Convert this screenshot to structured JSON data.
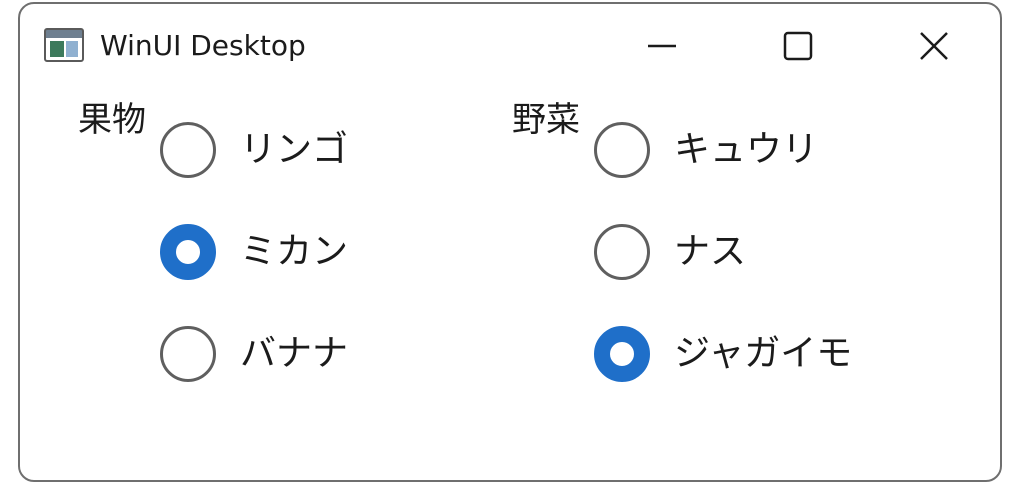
{
  "window": {
    "title": "WinUI Desktop"
  },
  "caption_buttons": {
    "minimize": "minimize-icon",
    "maximize": "maximize-icon",
    "close": "close-icon"
  },
  "groups": [
    {
      "label": "果物",
      "options": [
        {
          "label": "リンゴ",
          "checked": false
        },
        {
          "label": "ミカン",
          "checked": true
        },
        {
          "label": "バナナ",
          "checked": false
        }
      ]
    },
    {
      "label": "野菜",
      "options": [
        {
          "label": "キュウリ",
          "checked": false
        },
        {
          "label": "ナス",
          "checked": false
        },
        {
          "label": "ジャガイモ",
          "checked": true
        }
      ]
    }
  ],
  "colors": {
    "accent": "#1f6fc9",
    "border": "#6f6f6f",
    "text": "#1b1b1b"
  }
}
